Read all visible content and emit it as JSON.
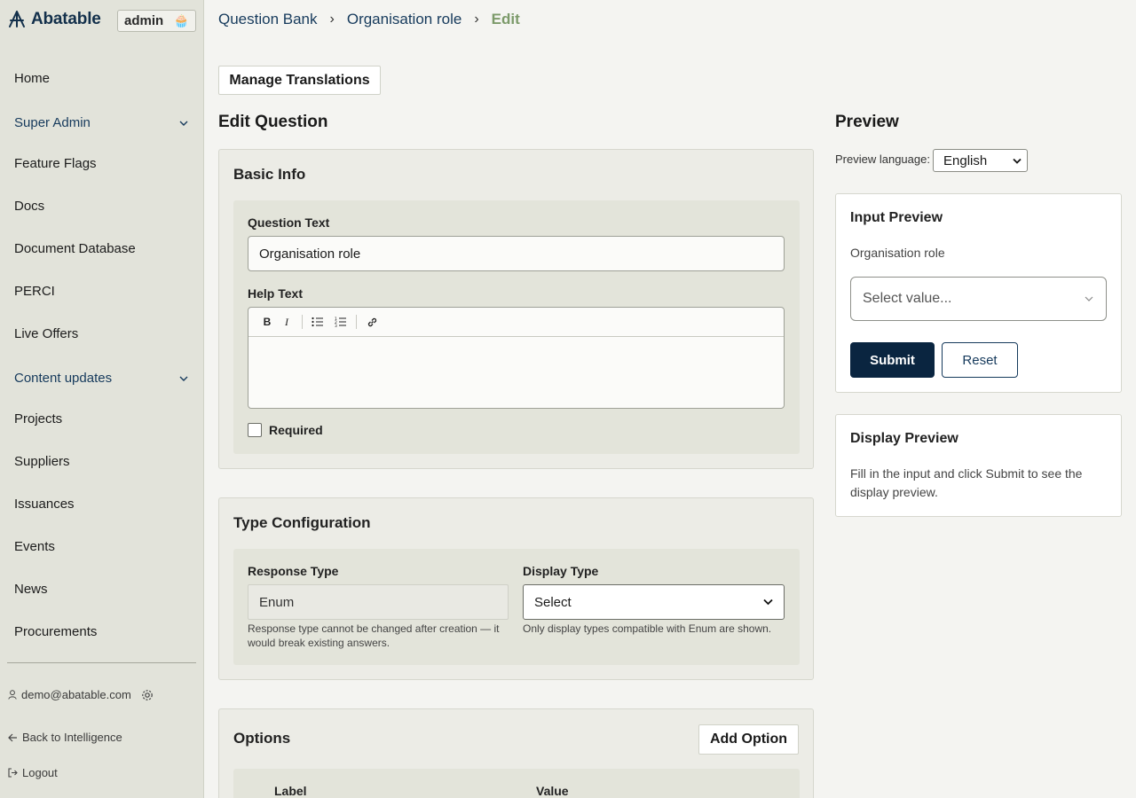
{
  "brand": {
    "name": "Abatable",
    "logo_icon": "abatable-logo-icon"
  },
  "role_badge": {
    "label": "admin",
    "icon": "cupcake-icon"
  },
  "sidebar": {
    "items": [
      {
        "label": "Home"
      },
      {
        "label": "Super Admin",
        "group": true
      },
      {
        "label": "Feature Flags"
      },
      {
        "label": "Docs"
      },
      {
        "label": "Document Database"
      },
      {
        "label": "PERCI"
      },
      {
        "label": "Live Offers"
      },
      {
        "label": "Content updates",
        "group": true
      },
      {
        "label": "Projects"
      },
      {
        "label": "Suppliers"
      },
      {
        "label": "Issuances"
      },
      {
        "label": "Events"
      },
      {
        "label": "News"
      },
      {
        "label": "Procurements"
      }
    ],
    "user_email": "demo@abatable.com",
    "back_link": "Back to Intelligence",
    "logout": "Logout"
  },
  "breadcrumb": [
    "Question Bank",
    "Organisation role",
    "Edit"
  ],
  "toolbar": {
    "manage_translations": "Manage Translations"
  },
  "edit": {
    "title": "Edit Question",
    "basic_info": {
      "title": "Basic Info",
      "question_text_label": "Question Text",
      "question_text_value": "Organisation role",
      "help_text_label": "Help Text",
      "required_label": "Required"
    },
    "type_config": {
      "title": "Type Configuration",
      "response_type_label": "Response Type",
      "response_type_value": "Enum",
      "response_type_hint": "Response type cannot be changed after creation — it would break existing answers.",
      "display_type_label": "Display Type",
      "display_type_value": "Select",
      "display_type_hint": "Only display types compatible with Enum are shown."
    },
    "options": {
      "title": "Options",
      "add_button": "Add Option",
      "columns": [
        "Label",
        "Value"
      ]
    }
  },
  "preview": {
    "title": "Preview",
    "language_label": "Preview language:",
    "language_value": "English",
    "input_preview": {
      "title": "Input Preview",
      "field_label": "Organisation role",
      "select_placeholder": "Select value...",
      "submit": "Submit",
      "reset": "Reset"
    },
    "display_preview": {
      "title": "Display Preview",
      "message": "Fill in the input and click Submit to see the display preview."
    }
  },
  "colors": {
    "brand_navy": "#0a2540",
    "link": "#163a5c",
    "current_crumb": "#7c9a6a"
  }
}
